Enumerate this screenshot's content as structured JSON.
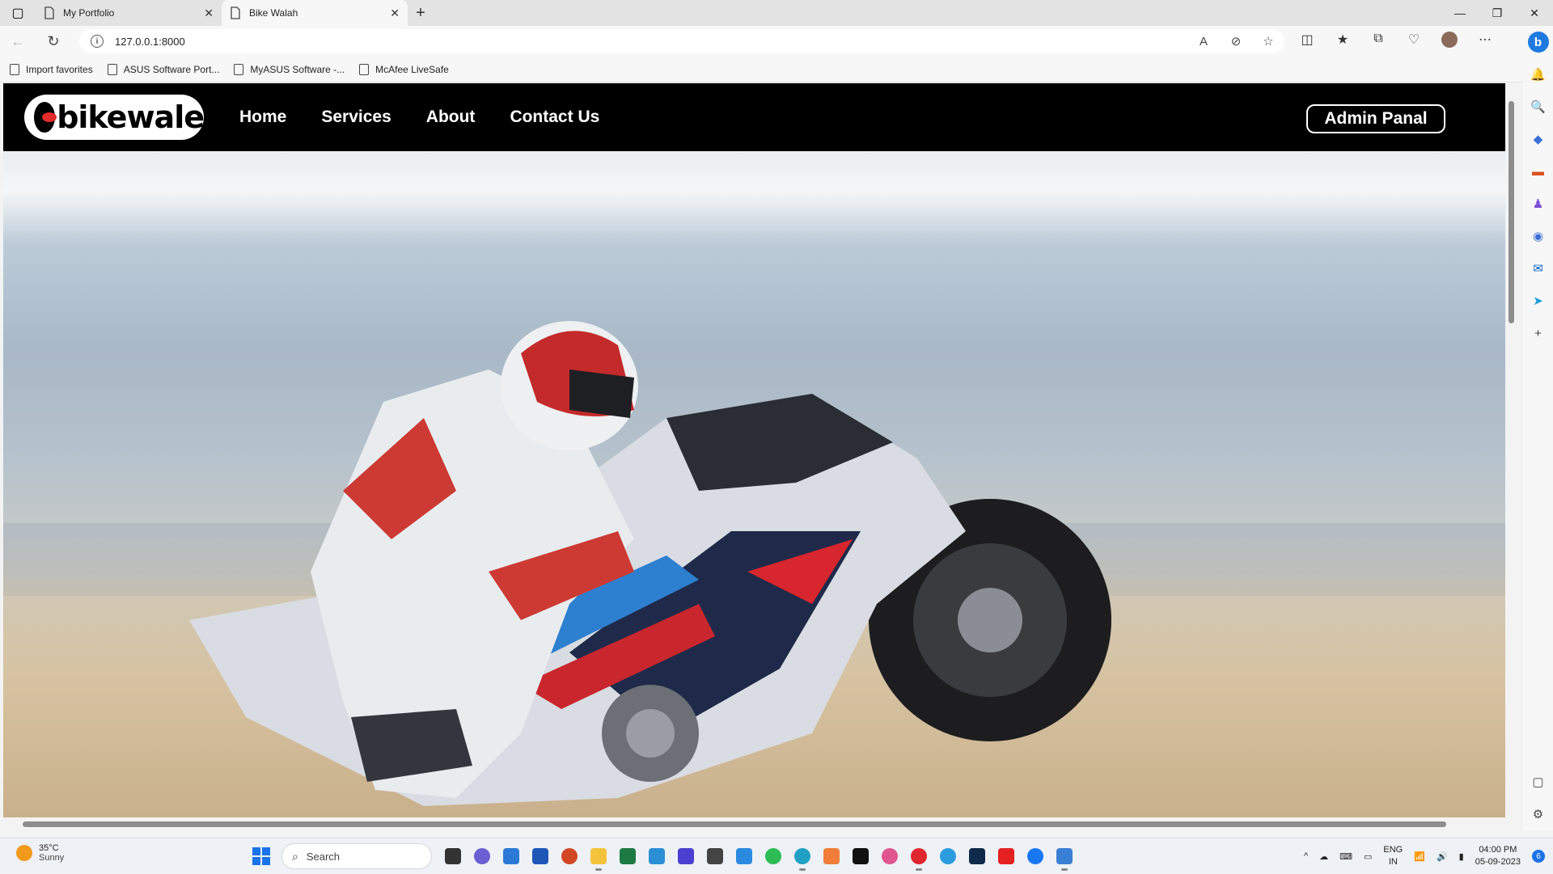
{
  "browser": {
    "tabs": [
      {
        "title": "My Portfolio",
        "active": false
      },
      {
        "title": "Bike Walah",
        "active": true
      }
    ],
    "url": "127.0.0.1:8000",
    "favorites": [
      "Import favorites",
      "ASUS Software Port...",
      "MyASUS Software -...",
      "McAfee LiveSafe"
    ]
  },
  "site": {
    "logo_text": "bikewale",
    "menu": [
      "Home",
      "Services",
      "About",
      "Contact Us"
    ],
    "admin_button": "Admin Panal",
    "hero_image": "motorcycle-racer-image"
  },
  "taskbar": {
    "weather_temp": "35°C",
    "weather_desc": "Sunny",
    "search_placeholder": "Search",
    "lang_line1": "ENG",
    "lang_line2": "IN",
    "time": "04:00 PM",
    "date": "05-09-2023",
    "notification_count": "6"
  },
  "colors": {
    "nav_bg": "#000000",
    "logo_accent": "#e32b2b",
    "edge_blue": "#1a73e8"
  }
}
